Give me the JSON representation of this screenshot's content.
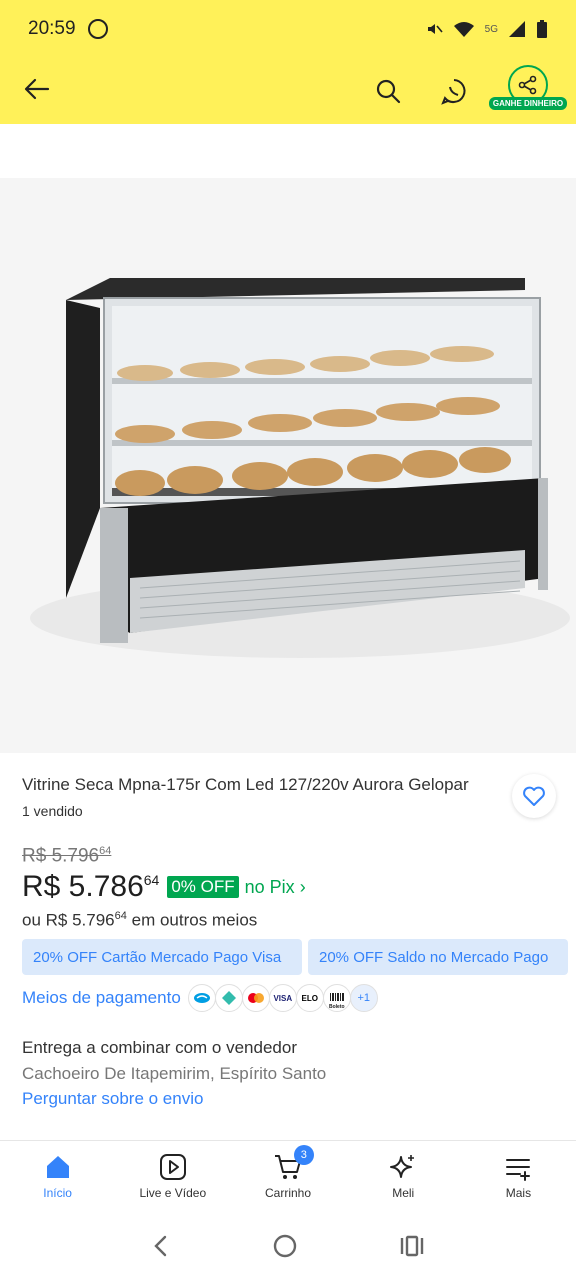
{
  "status_bar": {
    "time": "20:59",
    "network": "5G"
  },
  "header": {
    "back_icon": "arrow-left-icon",
    "share_badge": "GANHE DINHEIRO"
  },
  "product": {
    "title": "Vitrine Seca Mpna-175r Com Led 127/220v Aurora Gelopar",
    "sold": "1 vendido",
    "old_price": "R$ 5.796",
    "old_cents": "64",
    "price": "R$ 5.786",
    "price_cents": "64",
    "discount": "0% OFF",
    "pix_label": "no Pix",
    "other_prefix": "ou R$ 5.796",
    "other_cents": "64",
    "other_suffix": "em outros meios"
  },
  "promos": [
    "20% OFF Cartão Mercado Pago Visa",
    "20% OFF Saldo no Mercado Pago"
  ],
  "payment": {
    "link_label": "Meios de pagamento",
    "icons": [
      "VISA",
      "ELO",
      "Boleto"
    ],
    "more": "+1"
  },
  "shipping": {
    "line1": "Entrega a combinar com o vendedor",
    "line2": "Cachoeiro De Itapemirim, Espírito Santo",
    "link": "Perguntar sobre o envio"
  },
  "bottom_nav": [
    {
      "label": "Início",
      "icon": "home-icon",
      "active": true
    },
    {
      "label": "Live e Vídeo",
      "icon": "play-icon",
      "active": false
    },
    {
      "label": "Carrinho",
      "icon": "cart-icon",
      "active": false,
      "badge": "3"
    },
    {
      "label": "Meli",
      "icon": "sparkle-icon",
      "active": false
    },
    {
      "label": "Mais",
      "icon": "menu-plus-icon",
      "active": false
    }
  ],
  "colors": {
    "header_yellow": "#fff159",
    "accent_blue": "#3483fa",
    "green": "#00a650"
  }
}
